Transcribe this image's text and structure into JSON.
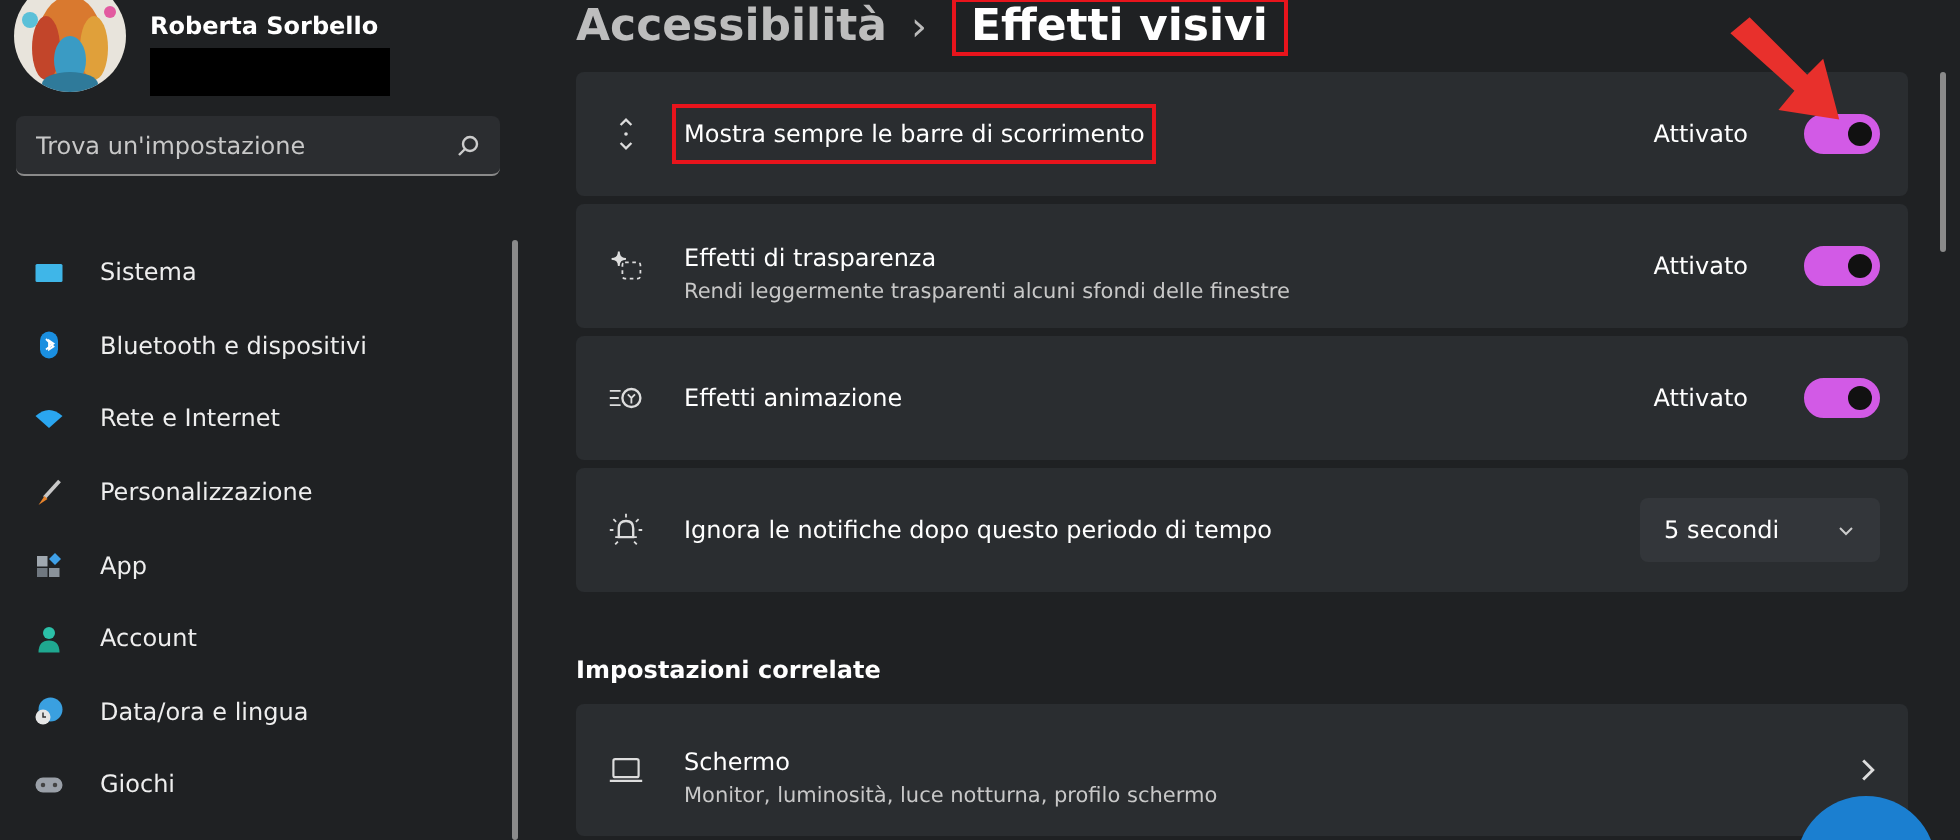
{
  "user": {
    "name": "Roberta Sorbello"
  },
  "search": {
    "placeholder": "Trova un'impostazione"
  },
  "sidebar": {
    "items": [
      {
        "label": "Sistema"
      },
      {
        "label": "Bluetooth e dispositivi"
      },
      {
        "label": "Rete e Internet"
      },
      {
        "label": "Personalizzazione"
      },
      {
        "label": "App"
      },
      {
        "label": "Account"
      },
      {
        "label": "Data/ora e lingua"
      },
      {
        "label": "Giochi"
      }
    ]
  },
  "breadcrumb": {
    "parent": "Accessibilità",
    "separator": "›",
    "current": "Effetti visivi",
    "current_highlighted": true
  },
  "settings": [
    {
      "kind": "toggle",
      "label": "Mostra sempre le barre di scorrimento",
      "highlighted": true,
      "status": "Attivato",
      "on": true,
      "arrow": true
    },
    {
      "kind": "toggle",
      "label": "Effetti di trasparenza",
      "description": "Rendi leggermente trasparenti alcuni sfondi delle finestre",
      "highlighted": false,
      "status": "Attivato",
      "on": true
    },
    {
      "kind": "toggle",
      "label": "Effetti animazione",
      "highlighted": false,
      "status": "Attivato",
      "on": true
    },
    {
      "kind": "dropdown",
      "label": "Ignora le notifiche dopo questo periodo di tempo",
      "highlighted": false,
      "value": "5 secondi"
    }
  ],
  "related": {
    "heading": "Impostazioni correlate",
    "items": [
      {
        "kind": "link",
        "label": "Schermo",
        "description": "Monitor, luminosità, luce notturna, profilo schermo"
      }
    ]
  }
}
